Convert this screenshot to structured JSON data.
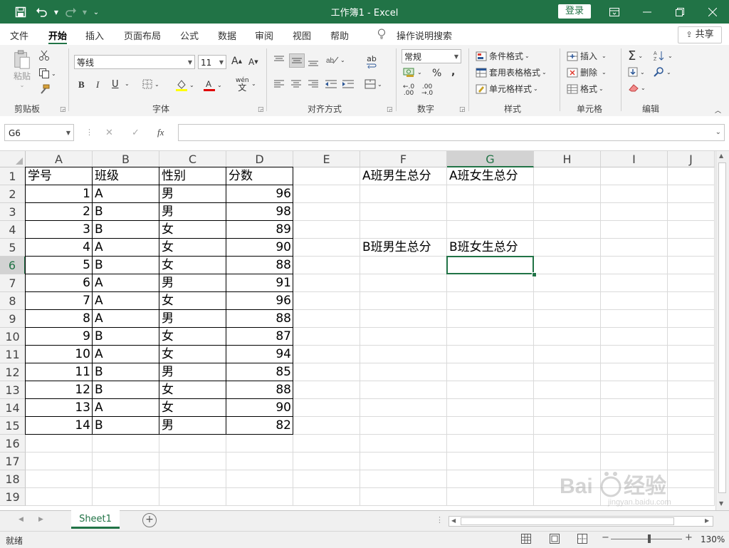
{
  "titlebar": {
    "title": "工作簿1  -  Excel",
    "signin_label": "登录",
    "accent": "#217346"
  },
  "menu": {
    "tabs": [
      "文件",
      "开始",
      "插入",
      "页面布局",
      "公式",
      "数据",
      "审阅",
      "视图",
      "帮助"
    ],
    "active": "开始",
    "tell_me": "操作说明搜索",
    "share_label": "共享"
  },
  "ribbon": {
    "clipboard": {
      "paste": "粘贴",
      "label": "剪贴板"
    },
    "font": {
      "name": "等线",
      "size": "11",
      "label": "字体",
      "bold": "B",
      "italic": "I",
      "underline": "U",
      "grow": "A",
      "shrink": "A",
      "phonetic": "wén"
    },
    "alignment": {
      "label": "对齐方式",
      "wrap": "ab"
    },
    "number": {
      "format": "常规",
      "label": "数字",
      "percent": "%",
      "comma": ","
    },
    "styles": {
      "conditional": "条件格式",
      "table": "套用表格格式",
      "cell": "单元格样式",
      "label": "样式"
    },
    "cells": {
      "insert": "插入",
      "delete": "删除",
      "format": "格式",
      "label": "单元格"
    },
    "editing": {
      "label": "编辑"
    }
  },
  "formula_bar": {
    "name_box": "G6",
    "fx": "fx",
    "cancel": "✕",
    "enter": "✓",
    "content": ""
  },
  "grid": {
    "columns": [
      "A",
      "B",
      "C",
      "D",
      "E",
      "F",
      "G",
      "H",
      "I",
      "J"
    ],
    "selected_column": "G",
    "rows": [
      "1",
      "2",
      "3",
      "4",
      "5",
      "6",
      "7",
      "8",
      "9",
      "10",
      "11",
      "12",
      "13",
      "14",
      "15",
      "16",
      "17",
      "18",
      "19"
    ],
    "selected_row": "6",
    "headers": [
      "学号",
      "班级",
      "性别",
      "分数"
    ],
    "data": [
      [
        "1",
        "A",
        "男",
        "96"
      ],
      [
        "2",
        "B",
        "男",
        "98"
      ],
      [
        "3",
        "B",
        "女",
        "89"
      ],
      [
        "4",
        "A",
        "女",
        "90"
      ],
      [
        "5",
        "B",
        "女",
        "88"
      ],
      [
        "6",
        "A",
        "男",
        "91"
      ],
      [
        "7",
        "A",
        "女",
        "96"
      ],
      [
        "8",
        "A",
        "男",
        "88"
      ],
      [
        "9",
        "B",
        "女",
        "87"
      ],
      [
        "10",
        "A",
        "女",
        "94"
      ],
      [
        "11",
        "B",
        "男",
        "85"
      ],
      [
        "12",
        "B",
        "女",
        "88"
      ],
      [
        "13",
        "A",
        "女",
        "90"
      ],
      [
        "14",
        "B",
        "男",
        "82"
      ]
    ],
    "side_labels": {
      "f1": "A班男生总分",
      "g1": "A班女生总分",
      "f5": "B班男生总分",
      "g5": "B班女生总分"
    }
  },
  "sheets": {
    "tabs": [
      "Sheet1"
    ],
    "add": "+"
  },
  "status": {
    "ready": "就绪",
    "zoom": "130%"
  },
  "watermark": "Baidu 经验 jingyan.baidu.com"
}
